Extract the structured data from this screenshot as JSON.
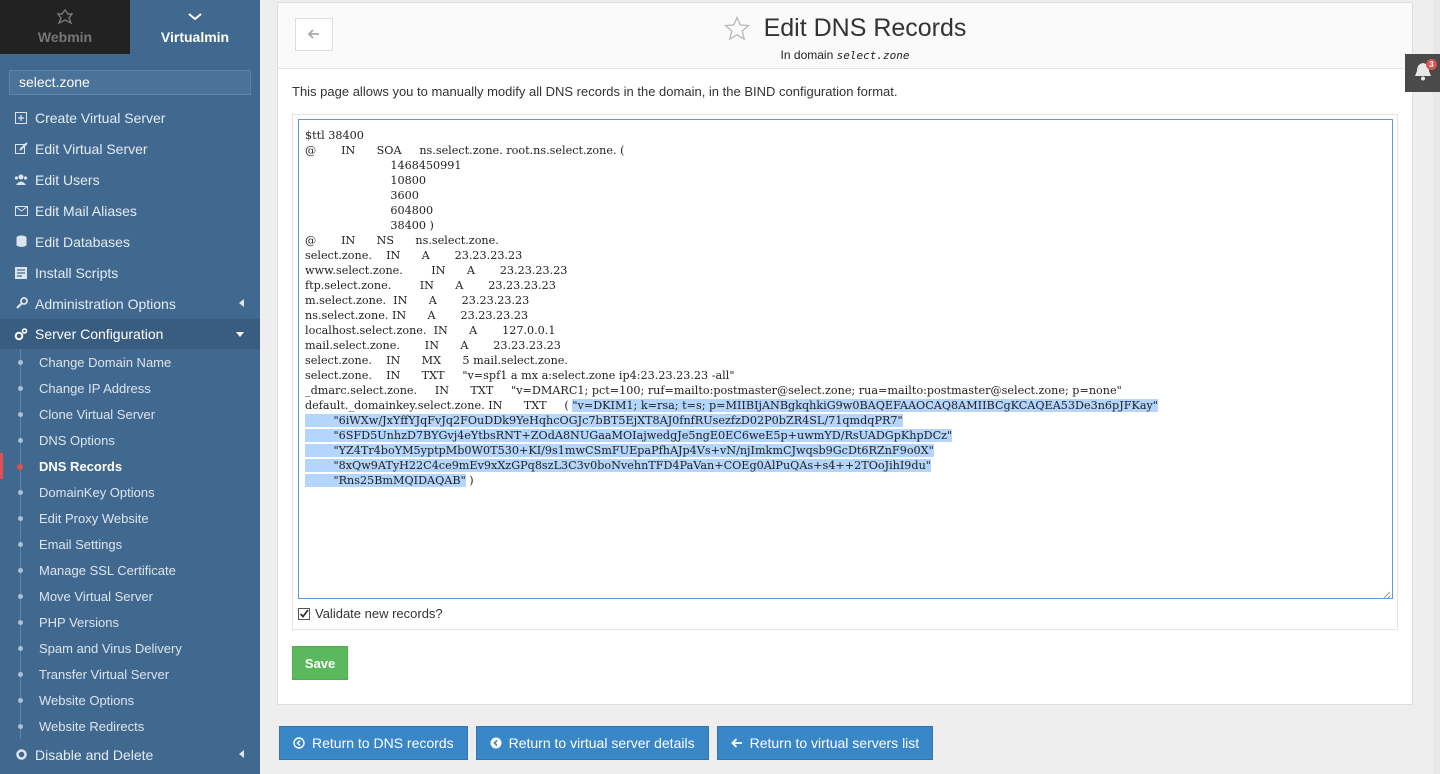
{
  "switcher": {
    "webmin_label": "Webmin",
    "virtualmin_label": "Virtualmin"
  },
  "domain_select": {
    "value": "select.zone"
  },
  "menu": [
    {
      "label": "Create Virtual Server",
      "icon": "plus-square-icon"
    },
    {
      "label": "Edit Virtual Server",
      "icon": "edit-icon"
    },
    {
      "label": "Edit Users",
      "icon": "users-icon"
    },
    {
      "label": "Edit Mail Aliases",
      "icon": "envelope-icon"
    },
    {
      "label": "Edit Databases",
      "icon": "database-icon"
    },
    {
      "label": "Install Scripts",
      "icon": "script-icon"
    },
    {
      "label": "Administration Options",
      "icon": "wrench-icon"
    }
  ],
  "server_config": {
    "label": "Server Configuration",
    "items": [
      "Change Domain Name",
      "Change IP Address",
      "Clone Virtual Server",
      "DNS Options",
      "DNS Records",
      "DomainKey Options",
      "Edit Proxy Website",
      "Email Settings",
      "Manage SSL Certificate",
      "Move Virtual Server",
      "PHP Versions",
      "Spam and Virus Delivery",
      "Transfer Virtual Server",
      "Website Options",
      "Website Redirects"
    ],
    "active_item": "DNS Records"
  },
  "disable_delete": {
    "label": "Disable and Delete"
  },
  "page": {
    "title": "Edit DNS Records",
    "subtitle_prefix": "In domain",
    "subtitle_domain": "select.zone",
    "description": "This page allows you to manually modify all DNS records in the domain, in the BIND configuration format."
  },
  "records_text": {
    "plain": "$ttl 38400\n@       IN      SOA     ns.select.zone. root.ns.select.zone. (\n                        1468450991\n                        10800\n                        3600\n                        604800\n                        38400 )\n@       IN      NS      ns.select.zone.\nselect.zone.    IN      A       23.23.23.23\nwww.select.zone.        IN      A       23.23.23.23\nftp.select.zone.        IN      A       23.23.23.23\nm.select.zone.  IN      A       23.23.23.23\nns.select.zone. IN      A       23.23.23.23\nlocalhost.select.zone.  IN      A       127.0.0.1\nmail.select.zone.       IN      A       23.23.23.23\nselect.zone.    IN      MX      5 mail.select.zone.\nselect.zone.    IN      TXT     \"v=spf1 a mx a:select.zone ip4:23.23.23.23 -all\"\n_dmarc.select.zone.     IN      TXT     \"v=DMARC1; pct=100; ruf=mailto:postmaster@select.zone; rua=mailto:postmaster@select.zone; p=none\"\ndefault._domainkey.select.zone. IN      TXT     ( ",
    "highlighted": "\"v=DKIM1; k=rsa; t=s; p=MIIBIjANBgkqhkiG9w0BAQEFAAOCAQ8AMIIBCgKCAQEA53De3n6pJFKay\"\n        \"6iWXw/JxYffYJqFvJq2FOuDDk9YeHqhcOGJc7bBT5EjXT8AJ0fnfRUsezfzD02P0bZR4SL/71qmdqPR7\"\n        \"6SFD5UnhzD7BYGvj4eYtbsRNT+ZOdA8NUGaaMOIajwedgJe5ngE0EC6weE5p+uwmYD/RsUADGpKhpDCz\"\n        \"YZ4Tr4boYM5yptpMb0W0T530+KI/9s1mwCSmFUEpaPfhAJp4Vs+vN/njImkmCJwqsb9GcDt6RZnF9o0X\"\n        \"8xQw9ATyH22C4ce9mEv9xXzGPq8szL3C3v0boNvehnTFD4PaVan+COEg0AlPuQAs+s4++2TOoJihI9du\"\n        \"Rns25BmMQIDAQAB\"",
    "tail": " )"
  },
  "validate": {
    "label": "Validate new records?",
    "checked": true
  },
  "buttons": {
    "save": "Save",
    "return_dns": "Return to DNS records",
    "return_details": "Return to virtual server details",
    "return_list": "Return to virtual servers list"
  },
  "notifications": {
    "count": "3"
  }
}
